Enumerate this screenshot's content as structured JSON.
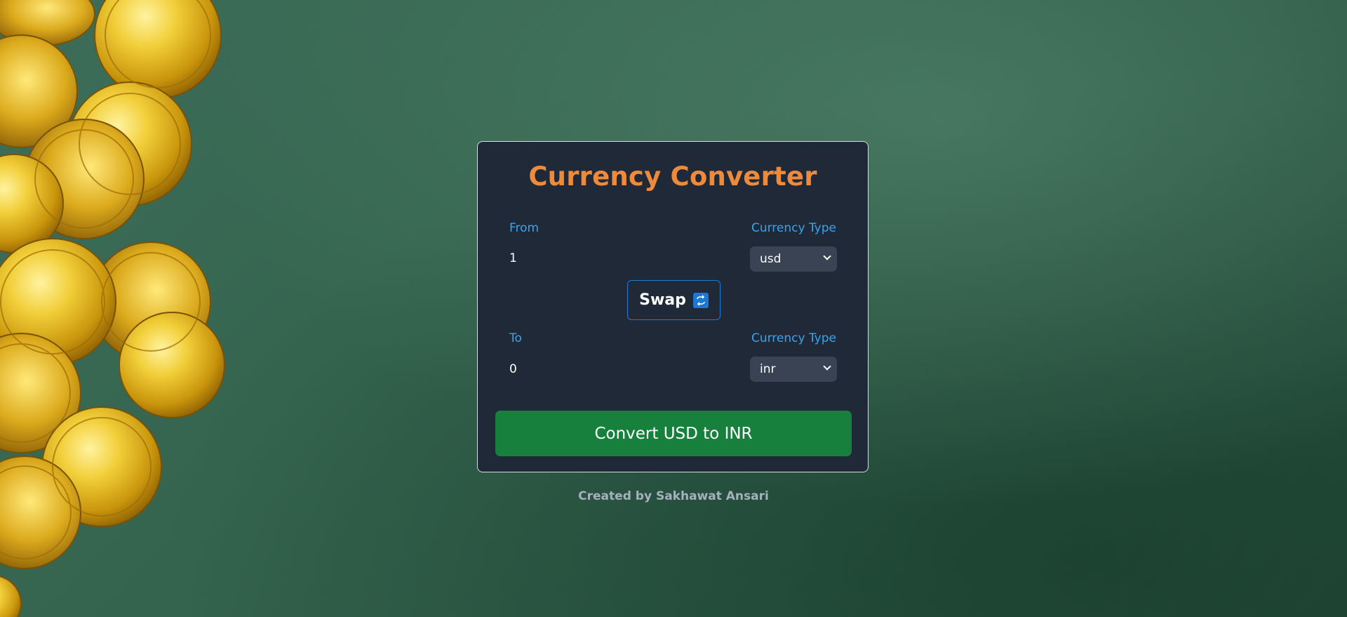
{
  "title": "Currency Converter",
  "from": {
    "label": "From",
    "type_label": "Currency Type",
    "amount": "1",
    "currency": "usd"
  },
  "swap": {
    "label": "Swap",
    "icon": "swap-arrows-icon"
  },
  "to": {
    "label": "To",
    "type_label": "Currency Type",
    "amount": "0",
    "currency": "inr"
  },
  "convert_label": "Convert USD to INR",
  "footer": "Created by Sakhawat Ansari",
  "colors": {
    "title": "#ee8a3c",
    "label": "#3aa3ee",
    "card_bg": "#1f2937",
    "select_bg": "#394353",
    "convert_bg": "#16803c",
    "swap_border": "#1f7bd1"
  }
}
